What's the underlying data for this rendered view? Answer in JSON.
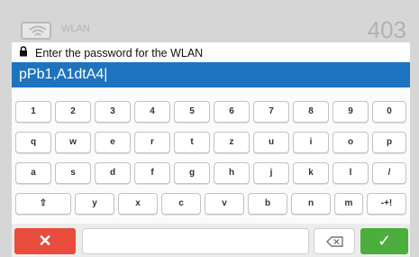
{
  "titlebar": {
    "title": "WLAN",
    "page_number": "403",
    "icon": "wifi-icon"
  },
  "prompt": {
    "lock_icon": "lock-icon",
    "text": "Enter the password for the WLAN"
  },
  "field": {
    "value": "pPb1,A1dtA4|"
  },
  "keyboard": {
    "row1": [
      "1",
      "2",
      "3",
      "4",
      "5",
      "6",
      "7",
      "8",
      "9",
      "0"
    ],
    "row2": [
      "q",
      "w",
      "e",
      "r",
      "t",
      "z",
      "u",
      "i",
      "o",
      "p"
    ],
    "row3": [
      "a",
      "s",
      "d",
      "f",
      "g",
      "h",
      "j",
      "k",
      "l",
      "/"
    ],
    "row4": [
      "⇧",
      "y",
      "x",
      "c",
      "v",
      "b",
      "n",
      "m",
      "-+!"
    ]
  },
  "bottom": {
    "cancel_label": "✕",
    "ok_label": "✓",
    "backspace_icon": "backspace-icon"
  },
  "colors": {
    "accent": "#1e73be",
    "cancel": "#e84c3d",
    "ok": "#4cae3c"
  }
}
